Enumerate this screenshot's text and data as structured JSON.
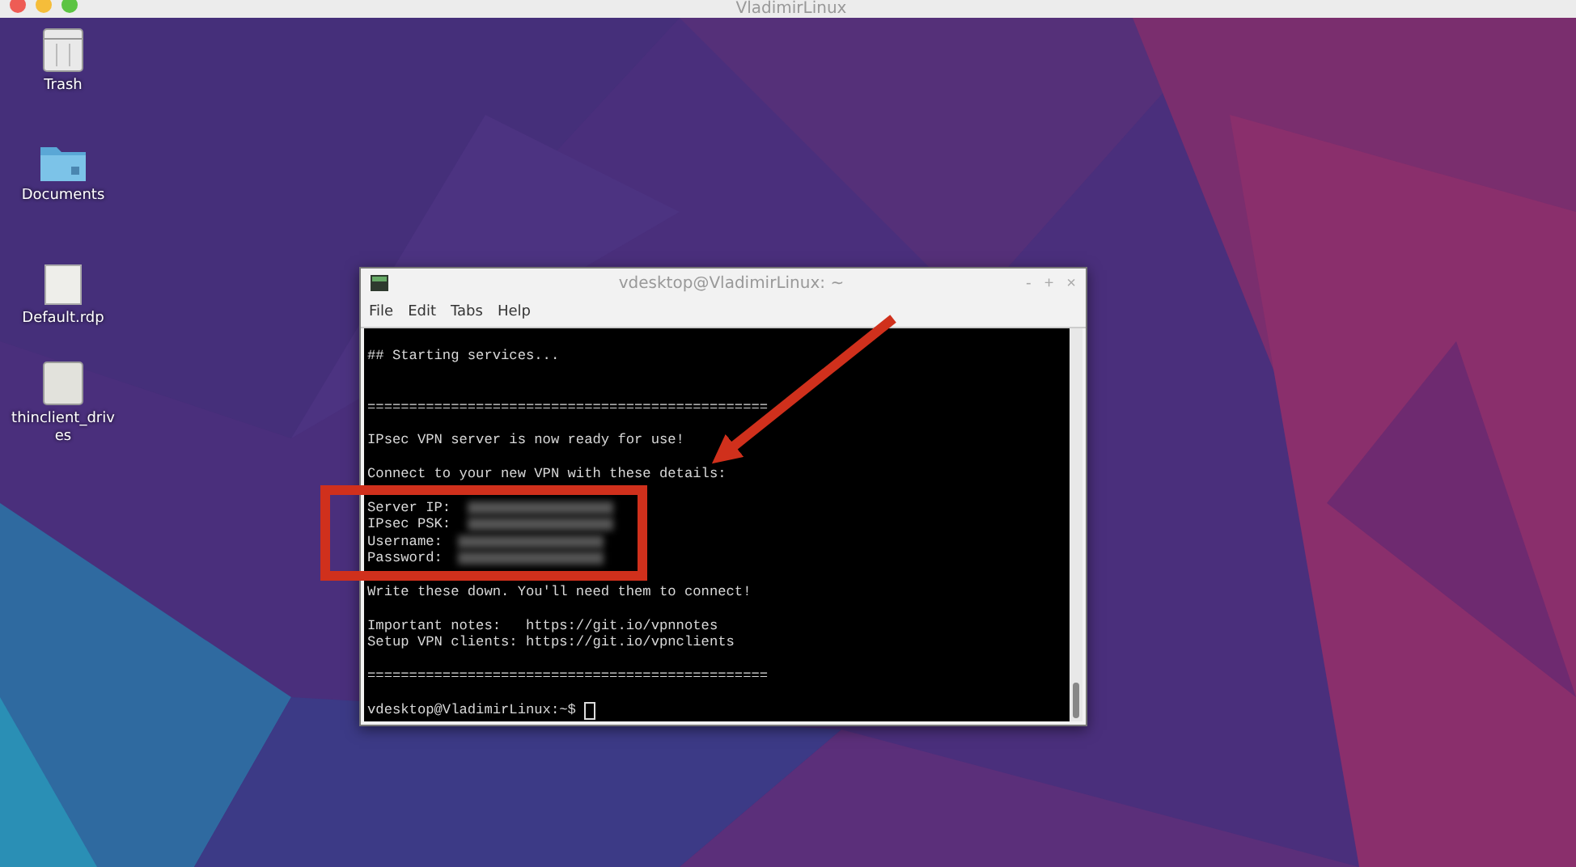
{
  "host_window": {
    "title": "VladimirLinux"
  },
  "desktop_icons": [
    {
      "kind": "trash",
      "label": "Trash"
    },
    {
      "kind": "folder",
      "label": "Documents"
    },
    {
      "kind": "file",
      "label": "Default.rdp"
    },
    {
      "kind": "drive",
      "label": "thinclient_drives"
    }
  ],
  "terminal": {
    "title": "vdesktop@VladimirLinux: ~",
    "controls": [
      "-",
      "+",
      "×"
    ],
    "menu": [
      "File",
      "Edit",
      "Tabs",
      "Help"
    ],
    "lines": [
      {
        "kind": "blank"
      },
      {
        "kind": "text",
        "text": "## Starting services..."
      },
      {
        "kind": "blank"
      },
      {
        "kind": "blank"
      },
      {
        "kind": "text",
        "text": "================================================"
      },
      {
        "kind": "blank"
      },
      {
        "kind": "text",
        "text": "IPsec VPN server is now ready for use!"
      },
      {
        "kind": "blank"
      },
      {
        "kind": "text",
        "text": "Connect to your new VPN with these details:"
      },
      {
        "kind": "blank"
      },
      {
        "kind": "secret",
        "text": "Server IP:"
      },
      {
        "kind": "secret",
        "text": "IPsec PSK:"
      },
      {
        "kind": "secret",
        "text": "Username:"
      },
      {
        "kind": "secret",
        "text": "Password:"
      },
      {
        "kind": "blank"
      },
      {
        "kind": "text",
        "text": "Write these down. You'll need them to connect!"
      },
      {
        "kind": "blank"
      },
      {
        "kind": "text",
        "text": "Important notes:   https://git.io/vpnnotes"
      },
      {
        "kind": "text",
        "text": "Setup VPN clients: https://git.io/vpnclients"
      },
      {
        "kind": "blank"
      },
      {
        "kind": "text",
        "text": "================================================"
      },
      {
        "kind": "blank"
      },
      {
        "kind": "prompt",
        "text": "vdesktop@VladimirLinux:~$"
      }
    ]
  },
  "annotation": {
    "kind": "arrow-and-box"
  }
}
